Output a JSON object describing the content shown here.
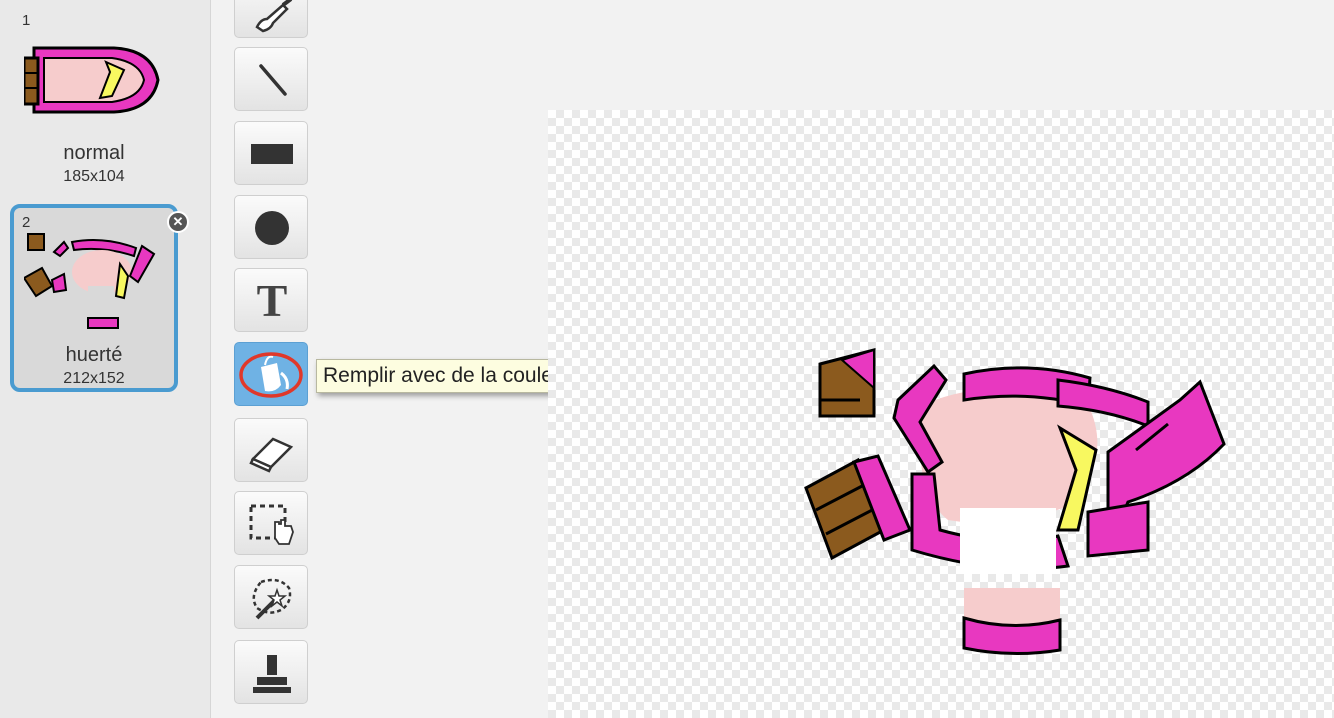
{
  "costumes": [
    {
      "number": "1",
      "name": "normal",
      "dimensions": "185x104",
      "selected": false
    },
    {
      "number": "2",
      "name": "huerté",
      "dimensions": "212x152",
      "selected": true
    }
  ],
  "costume_delete_icon": "close-icon",
  "tools": [
    {
      "name": "brush",
      "icon": "brush-icon"
    },
    {
      "name": "line",
      "icon": "line-icon"
    },
    {
      "name": "rectangle",
      "icon": "rectangle-icon"
    },
    {
      "name": "ellipse",
      "icon": "ellipse-icon"
    },
    {
      "name": "text",
      "icon": "text-icon",
      "glyph": "T"
    },
    {
      "name": "fill",
      "icon": "paint-bucket-icon",
      "active": true
    },
    {
      "name": "eraser",
      "icon": "eraser-icon"
    },
    {
      "name": "select",
      "icon": "select-icon"
    },
    {
      "name": "magic-select",
      "icon": "magic-wand-icon"
    },
    {
      "name": "stamp",
      "icon": "stamp-icon"
    }
  ],
  "tooltip": {
    "text": "Remplir avec de la couleur"
  },
  "colors": {
    "accent_blue": "#4a9bd0",
    "active_tool": "#6fb2e4",
    "highlight_ring": "#e0382a",
    "boat_magenta": "#e838c0",
    "boat_pink": "#f6cccc",
    "boat_brown": "#8b5a1e",
    "boat_yellow": "#f8f860"
  }
}
